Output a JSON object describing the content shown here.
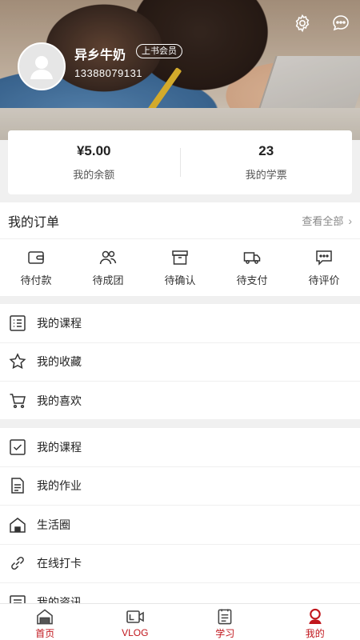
{
  "profile": {
    "username": "异乡牛奶",
    "member_badge": "上书会员",
    "phone": "13388079131"
  },
  "header_icons": [
    "settings-icon",
    "message-icon"
  ],
  "balance": {
    "amount": "¥5.00",
    "amount_label": "我的余额",
    "tickets": "23",
    "tickets_label": "我的学票"
  },
  "orders": {
    "title": "我的订单",
    "view_all": "查看全部",
    "items": [
      {
        "label": "待付款",
        "icon": "wallet-icon"
      },
      {
        "label": "待成团",
        "icon": "group-icon"
      },
      {
        "label": "待确认",
        "icon": "box-icon"
      },
      {
        "label": "待支付",
        "icon": "truck-icon"
      },
      {
        "label": "待评价",
        "icon": "comment-icon"
      }
    ]
  },
  "list1": [
    {
      "label": "我的课程",
      "icon": "list-icon"
    },
    {
      "label": "我的收藏",
      "icon": "star-icon"
    },
    {
      "label": "我的喜欢",
      "icon": "cart-icon"
    }
  ],
  "list2": [
    {
      "label": "我的课程",
      "icon": "checkbox-icon"
    },
    {
      "label": "我的作业",
      "icon": "document-icon"
    },
    {
      "label": "生活圈",
      "icon": "home-icon"
    },
    {
      "label": "在线打卡",
      "icon": "link-icon"
    },
    {
      "label": "我的资讯",
      "icon": "news-icon"
    }
  ],
  "tabs": [
    {
      "label": "首页",
      "icon": "home-tab-icon"
    },
    {
      "label": "VLOG",
      "icon": "camera-tab-icon"
    },
    {
      "label": "学习",
      "icon": "study-tab-icon"
    },
    {
      "label": "我的",
      "icon": "profile-tab-icon"
    }
  ],
  "colors": {
    "accent": "#c0161c",
    "background": "#f0f0f0"
  }
}
